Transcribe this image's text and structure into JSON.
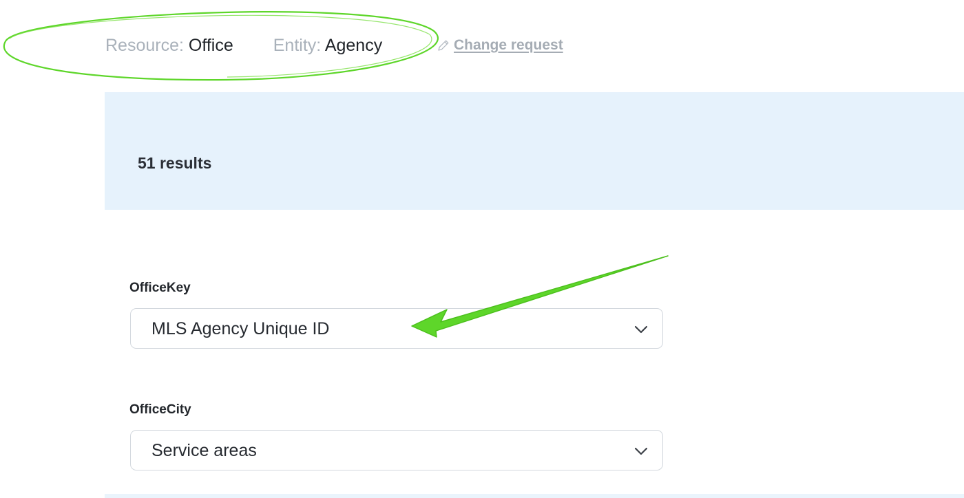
{
  "header": {
    "resource_key": "Resource:",
    "resource_value": "Office",
    "entity_key": "Entity:",
    "entity_value": "Agency",
    "change_request_label": "Change request"
  },
  "results": {
    "count_label": "51 results"
  },
  "fields": [
    {
      "label": "OfficeKey",
      "selected": "MLS Agency Unique ID"
    },
    {
      "label": "OfficeCity",
      "selected": "Service areas"
    }
  ],
  "colors": {
    "accent_band": "#e6f2fc",
    "annotation_green": "#5ed62a",
    "muted_text": "#a9b1ba"
  },
  "icons": {
    "change_request": "pencil-icon",
    "select_toggle": "chevron-down-icon"
  }
}
